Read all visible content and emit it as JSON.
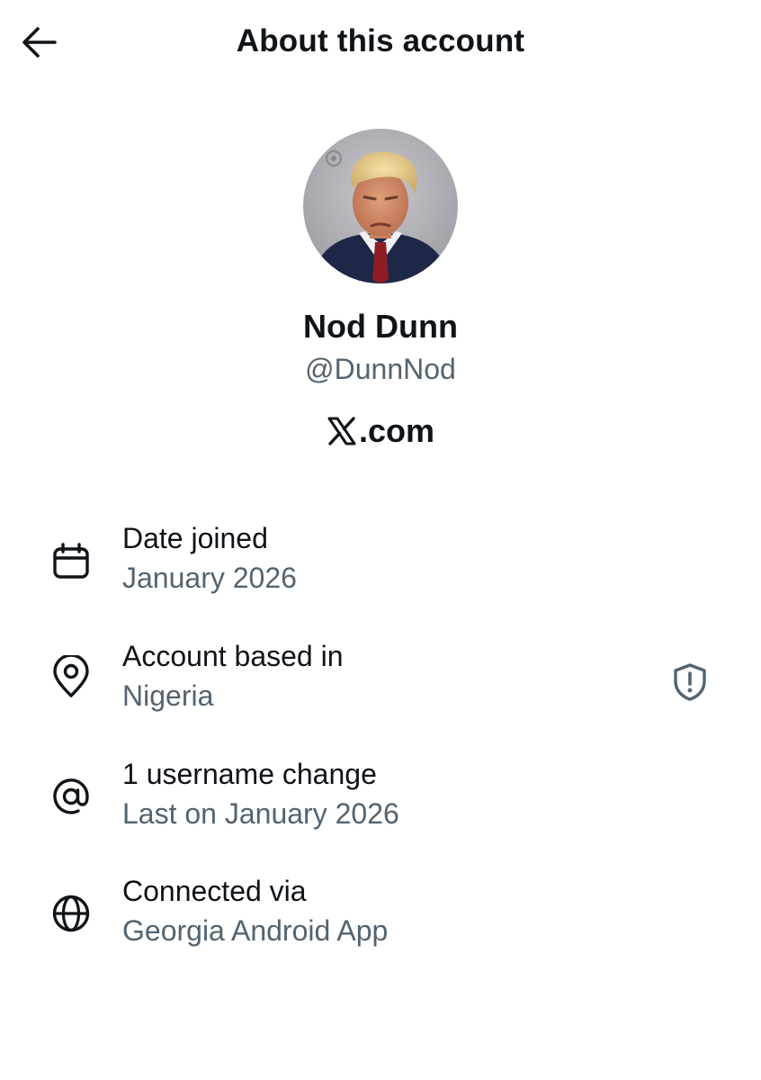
{
  "header": {
    "back_icon": "arrow-left-icon",
    "title": "About this account"
  },
  "profile": {
    "display_name": "Nod Dunn",
    "handle": "@DunnNod",
    "site_logo_icon": "x-logo-icon",
    "site_text": ".com"
  },
  "rows": [
    {
      "icon": "calendar-icon",
      "title": "Date joined",
      "subtitle": "January 2026"
    },
    {
      "icon": "location-pin-icon",
      "title": "Account based in",
      "subtitle": "Nigeria",
      "trailing_icon": "shield-alert-icon"
    },
    {
      "icon": "at-sign-icon",
      "title": "1 username change",
      "subtitle": "Last on January 2026"
    },
    {
      "icon": "globe-icon",
      "title": "Connected via",
      "subtitle": "Georgia Android App"
    }
  ],
  "colors": {
    "primary_text": "#0f1419",
    "secondary_text": "#536471",
    "background": "#ffffff"
  }
}
